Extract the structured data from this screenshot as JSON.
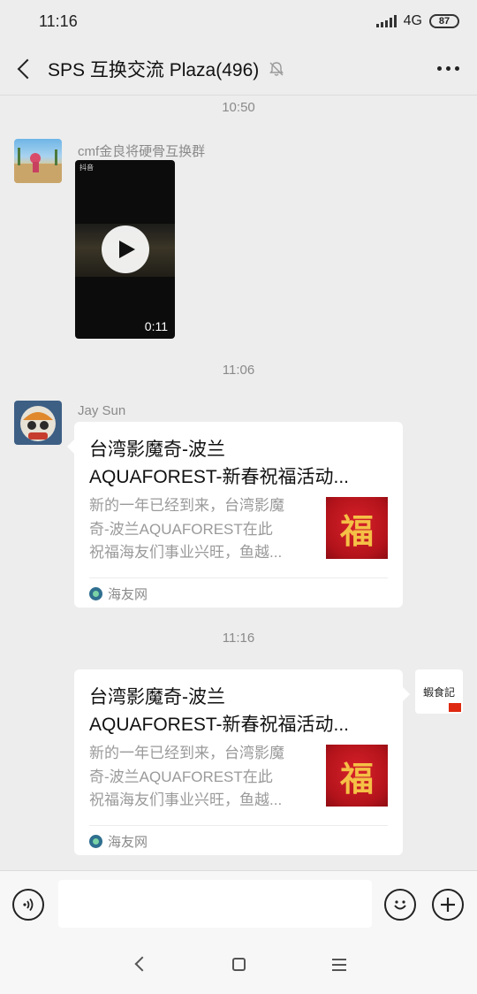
{
  "status_bar": {
    "time": "11:16",
    "network": "4G",
    "battery": "87"
  },
  "header": {
    "title": "SPS 互换交流 Plaza(496)"
  },
  "messages": [
    {
      "timestamp": "10:50",
      "sender": "cmf金良将硬骨互换群",
      "type": "video",
      "duration": "0:11",
      "tiktok_label": "抖音"
    },
    {
      "timestamp": "11:06",
      "sender": "Jay Sun",
      "type": "link",
      "title_lines": [
        "台湾影魔奇-波兰",
        "AQUAFOREST-新春祝福活动..."
      ],
      "desc_lines": [
        "新的一年已经到来，台湾影魔",
        "奇-波兰AQUAFOREST在此",
        "祝福海友们事业兴旺，鱼越..."
      ],
      "thumb_char": "福",
      "source": "海友网"
    },
    {
      "timestamp": "11:16",
      "sender": "",
      "type": "link",
      "title_lines": [
        "台湾影魔奇-波兰",
        "AQUAFOREST-新春祝福活动..."
      ],
      "desc_lines": [
        "新的一年已经到来，台湾影魔",
        "奇-波兰AQUAFOREST在此",
        "祝福海友们事业兴旺，鱼越..."
      ],
      "thumb_char": "福",
      "source": "海友网",
      "own_avatar_text": "蝦食記"
    }
  ],
  "icons": {
    "back": "back-arrow-icon",
    "mute": "bell-muted-icon",
    "more": "more-dots-icon",
    "voice": "voice-icon",
    "emoji": "emoji-icon",
    "plus": "plus-icon"
  },
  "colors": {
    "background": "#ededed",
    "bubble": "#ffffff",
    "thumb_red": "#c4161c"
  }
}
